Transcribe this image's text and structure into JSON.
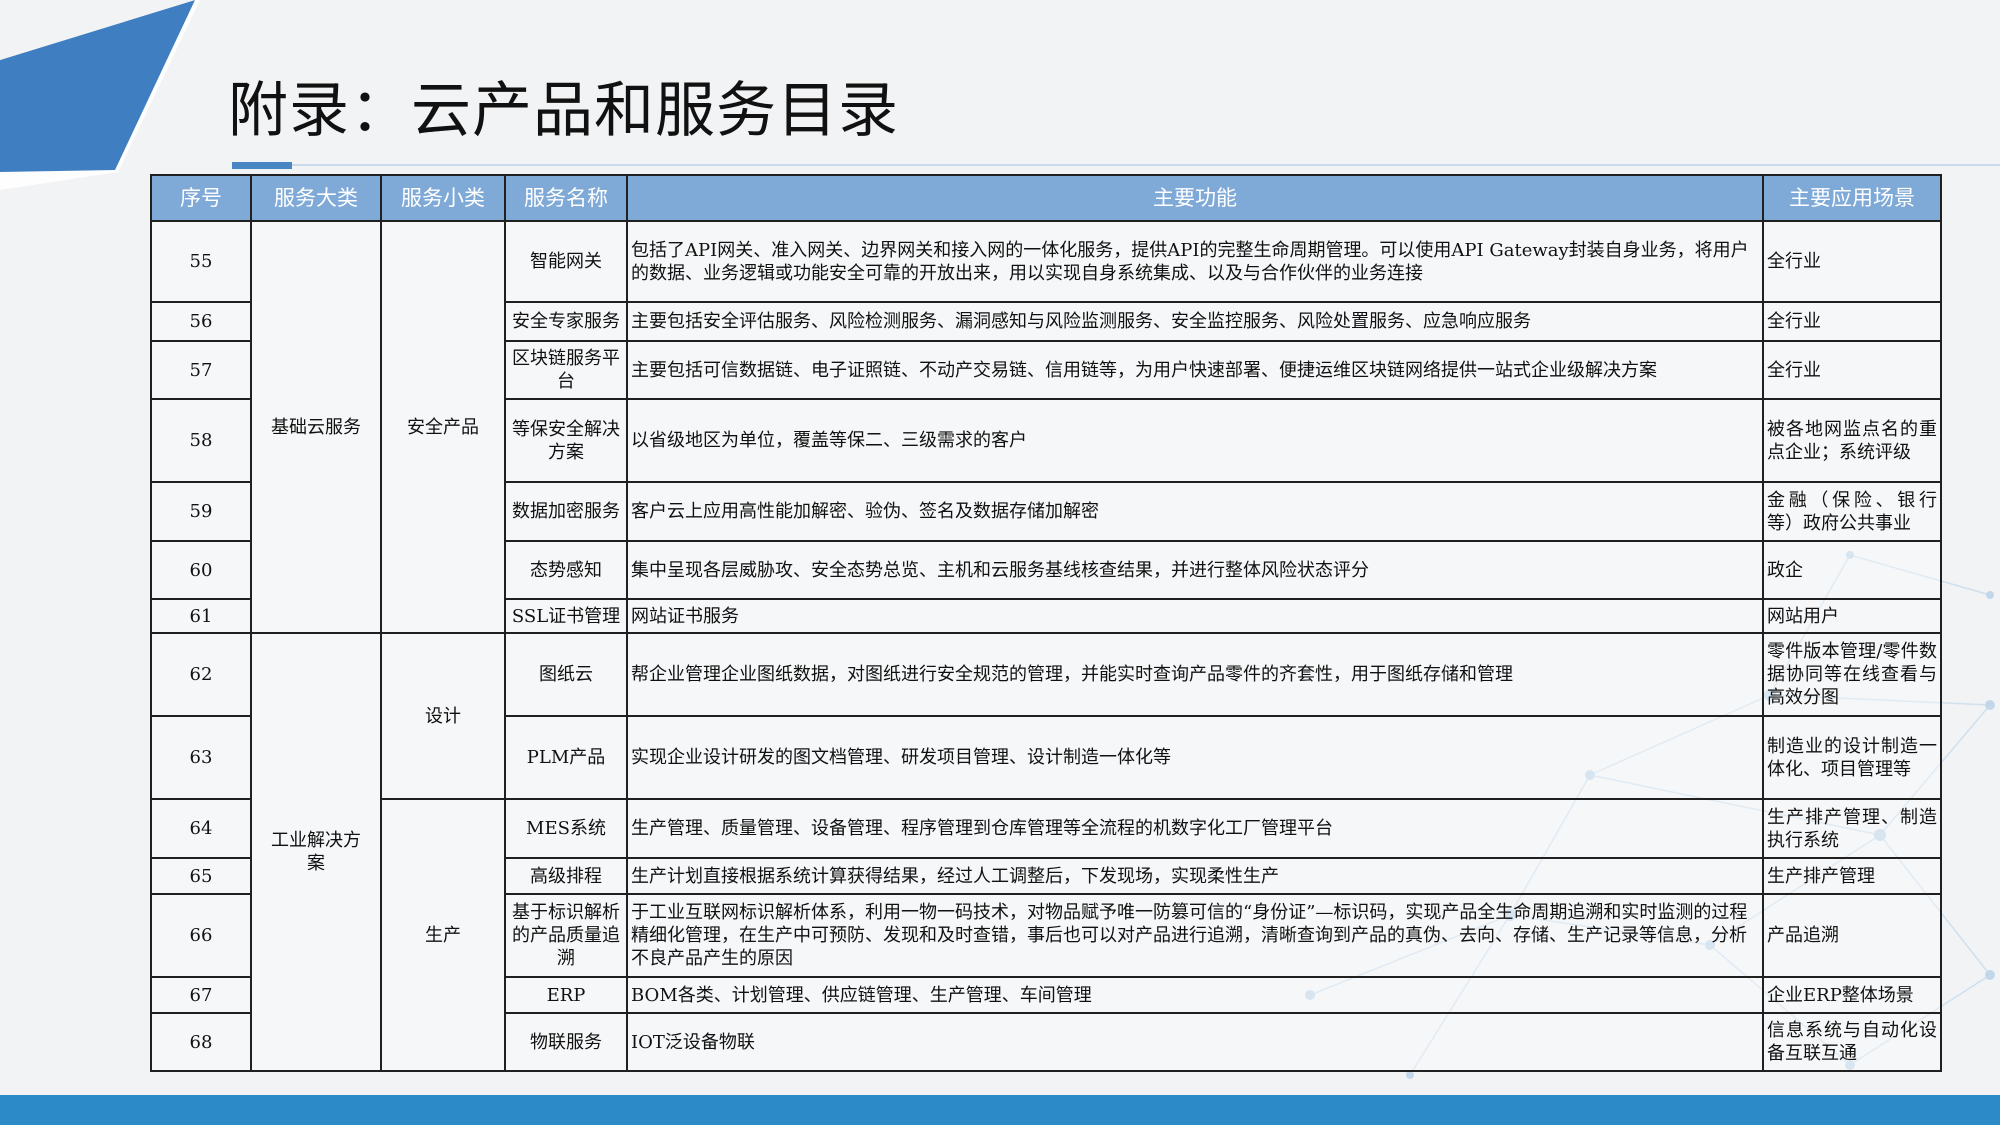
{
  "title": "附录：云产品和服务目录",
  "colors": {
    "header": "#7fa9d6",
    "accent": "#2d8ac9",
    "corner": "#3f7ec0"
  },
  "headers": {
    "seq": "序号",
    "cat": "服务大类",
    "sub": "服务小类",
    "name": "服务名称",
    "func": "主要功能",
    "scene": "主要应用场景"
  },
  "groups": {
    "cat1": "基础云服务",
    "cat2": "工业解决方案",
    "sub1": "安全产品",
    "sub2": "设计",
    "sub3": "生产"
  },
  "rows": [
    {
      "no": "55",
      "name": "智能网关",
      "func": "包括了API网关、准入网关、边界网关和接入网的一体化服务，提供API的完整生命周期管理。可以使用API Gateway封装自身业务，将用户的数据、业务逻辑或功能安全可靠的开放出来，用以实现自身系统集成、以及与合作伙伴的业务连接",
      "scene": "全行业"
    },
    {
      "no": "56",
      "name": "安全专家服务",
      "func": "主要包括安全评估服务、风险检测服务、漏洞感知与风险监测服务、安全监控服务、风险处置服务、应急响应服务",
      "scene": "全行业"
    },
    {
      "no": "57",
      "name": "区块链服务平台",
      "func": "主要包括可信数据链、电子证照链、不动产交易链、信用链等，为用户快速部署、便捷运维区块链网络提供一站式企业级解决方案",
      "scene": "全行业"
    },
    {
      "no": "58",
      "name": "等保安全解决方案",
      "func": "以省级地区为单位，覆盖等保二、三级需求的客户",
      "scene": "被各地网监点名的重点企业；系统评级"
    },
    {
      "no": "59",
      "name": "数据加密服务",
      "func": "客户云上应用高性能加解密、验伪、签名及数据存储加解密",
      "scene": "金融（保险、银行等）政府公共事业"
    },
    {
      "no": "60",
      "name": "态势感知",
      "func": "集中呈现各层威胁攻、安全态势总览、主机和云服务基线核查结果，并进行整体风险状态评分",
      "scene": "政企"
    },
    {
      "no": "61",
      "name": "SSL证书管理",
      "func": "网站证书服务",
      "scene": "网站用户"
    },
    {
      "no": "62",
      "name": "图纸云",
      "func": "帮企业管理企业图纸数据，对图纸进行安全规范的管理，并能实时查询产品零件的齐套性，用于图纸存储和管理",
      "scene": "零件版本管理/零件数据协同等在线查看与高效分图"
    },
    {
      "no": "63",
      "name": "PLM产品",
      "func": "实现企业设计研发的图文档管理、研发项目管理、设计制造一体化等",
      "scene": "制造业的设计制造一体化、项目管理等"
    },
    {
      "no": "64",
      "name": "MES系统",
      "func": "生产管理、质量管理、设备管理、程序管理到仓库管理等全流程的机数字化工厂管理平台",
      "scene": "生产排产管理、制造执行系统"
    },
    {
      "no": "65",
      "name": "高级排程",
      "func": "生产计划直接根据系统计算获得结果，经过人工调整后，下发现场，实现柔性生产",
      "scene": "生产排产管理"
    },
    {
      "no": "66",
      "name": "基于标识解析的产品质量追溯",
      "func": "于工业互联网标识解析体系，利用一物一码技术，对物品赋予唯一防篡可信的“身份证”—标识码，实现产品全生命周期追溯和实时监测的过程精细化管理，在生产中可预防、发现和及时查错，事后也可以对产品进行追溯，清晰查询到产品的真伪、去向、存储、生产记录等信息，分析不良产品产生的原因",
      "scene": "产品追溯"
    },
    {
      "no": "67",
      "name": "ERP",
      "func": "BOM各类、计划管理、供应链管理、生产管理、车间管理",
      "scene": "企业ERP整体场景"
    },
    {
      "no": "68",
      "name": "物联服务",
      "func": "IOT泛设备物联",
      "scene": "信息系统与自动化设备互联互通"
    }
  ]
}
